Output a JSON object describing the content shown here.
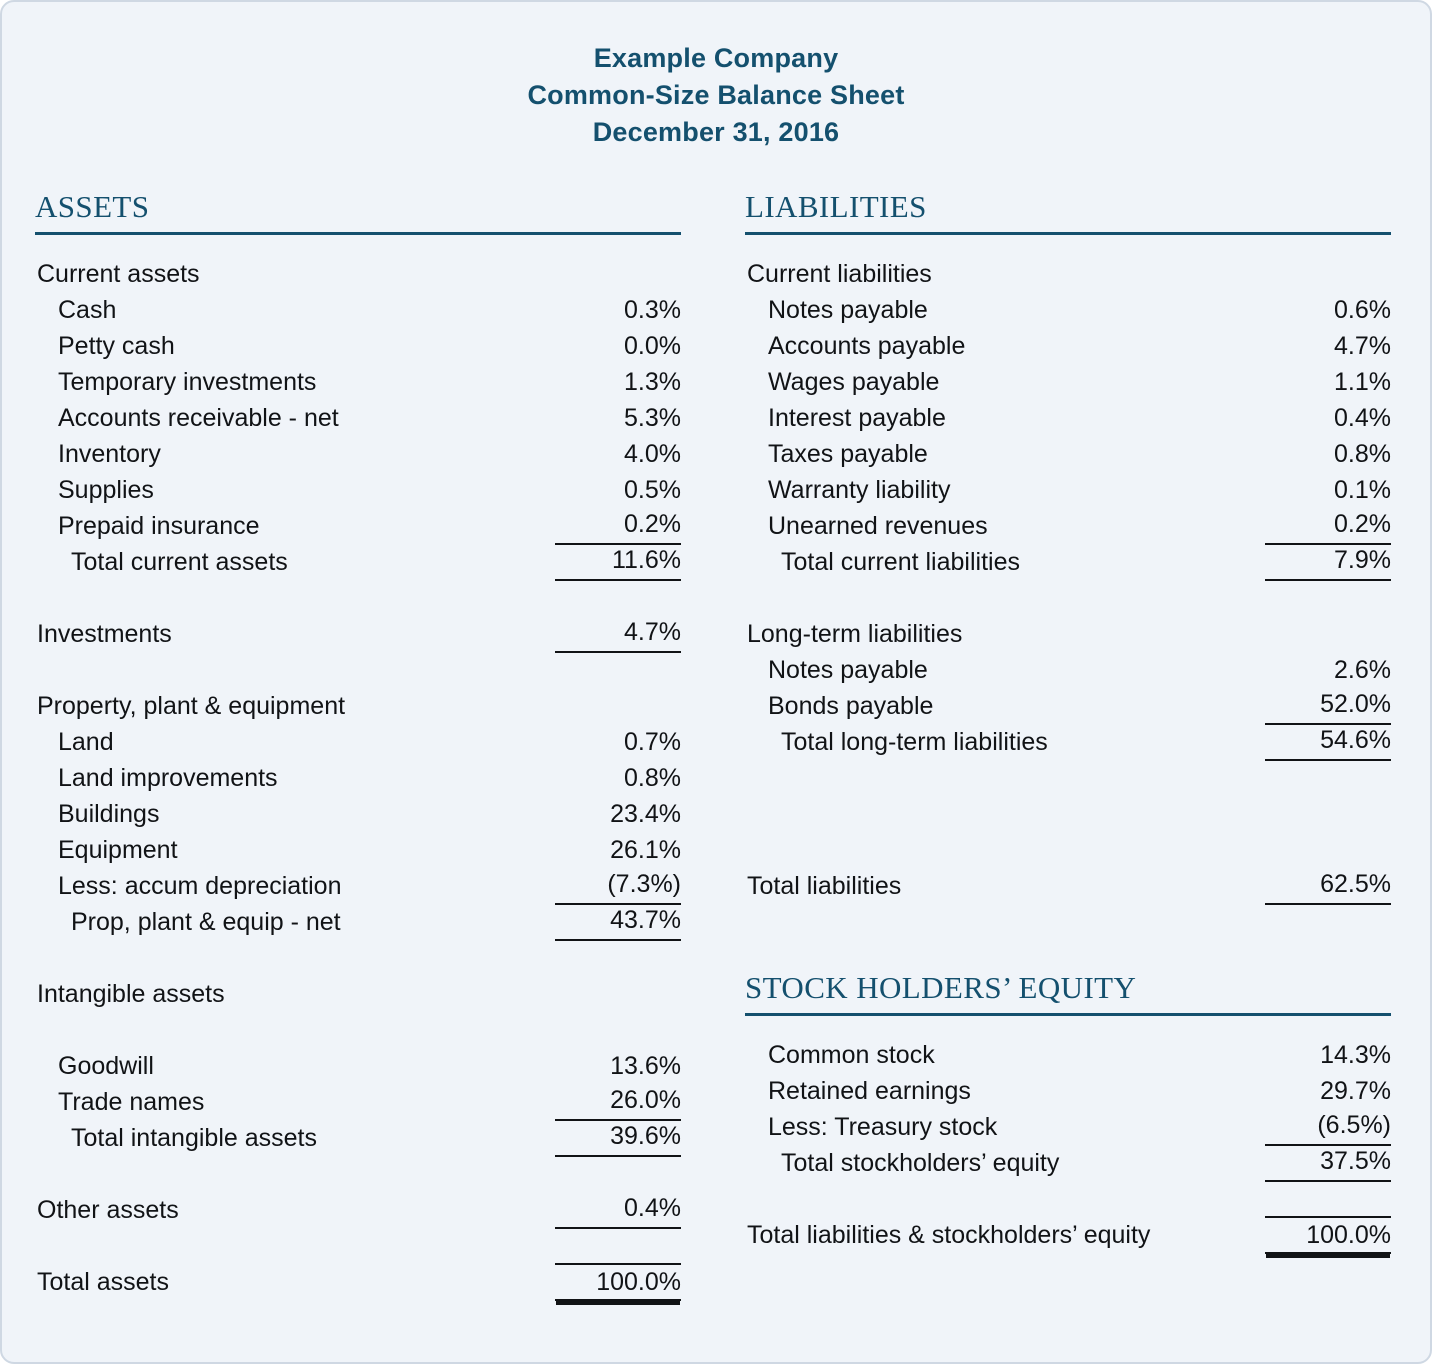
{
  "document": {
    "company": "Example Company",
    "statement_title": "Common-Size Balance Sheet",
    "date": "December 31, 2016",
    "accent_color": "#14506e",
    "text_color": "#111316",
    "background_color": "#f0f4f9",
    "border_color": "#cfd8e3"
  },
  "left_column": {
    "heading": "ASSETS",
    "rows": [
      {
        "label": "Current assets",
        "amount": "",
        "indent": 0,
        "rule": "none"
      },
      {
        "label": "Cash",
        "amount": "0.3%",
        "indent": 1,
        "rule": "none"
      },
      {
        "label": "Petty cash",
        "amount": "0.0%",
        "indent": 1,
        "rule": "none"
      },
      {
        "label": "Temporary investments",
        "amount": "1.3%",
        "indent": 1,
        "rule": "none"
      },
      {
        "label": "Accounts receivable - net",
        "amount": "5.3%",
        "indent": 1,
        "rule": "none"
      },
      {
        "label": "Inventory",
        "amount": "4.0%",
        "indent": 1,
        "rule": "none"
      },
      {
        "label": "Supplies",
        "amount": "0.5%",
        "indent": 1,
        "rule": "none"
      },
      {
        "label": "Prepaid insurance",
        "amount": "0.2%",
        "indent": 1,
        "rule": "bottom"
      },
      {
        "label": "Total current assets",
        "amount": "11.6%",
        "indent": 2,
        "rule": "bottom"
      },
      {
        "label": "",
        "amount": "",
        "indent": 0,
        "rule": "spacer"
      },
      {
        "label": "Investments",
        "amount": "4.7%",
        "indent": 0,
        "rule": "bottom"
      },
      {
        "label": "",
        "amount": "",
        "indent": 0,
        "rule": "spacer"
      },
      {
        "label": "Property, plant & equipment",
        "amount": "",
        "indent": 0,
        "rule": "none"
      },
      {
        "label": "Land",
        "amount": "0.7%",
        "indent": 1,
        "rule": "none"
      },
      {
        "label": "Land improvements",
        "amount": "0.8%",
        "indent": 1,
        "rule": "none"
      },
      {
        "label": "Buildings",
        "amount": "23.4%",
        "indent": 1,
        "rule": "none"
      },
      {
        "label": "Equipment",
        "amount": "26.1%",
        "indent": 1,
        "rule": "none"
      },
      {
        "label": "Less: accum depreciation",
        "amount": "(7.3%)",
        "indent": 1,
        "rule": "bottom"
      },
      {
        "label": "Prop, plant & equip - net",
        "amount": "43.7%",
        "indent": 2,
        "rule": "bottom"
      },
      {
        "label": "",
        "amount": "",
        "indent": 0,
        "rule": "spacer"
      },
      {
        "label": "Intangible assets",
        "amount": "",
        "indent": 0,
        "rule": "none"
      },
      {
        "label": "",
        "amount": "",
        "indent": 0,
        "rule": "spacer"
      },
      {
        "label": "Goodwill",
        "amount": "13.6%",
        "indent": 1,
        "rule": "none"
      },
      {
        "label": "Trade names",
        "amount": "26.0%",
        "indent": 1,
        "rule": "bottom"
      },
      {
        "label": "Total intangible assets",
        "amount": "39.6%",
        "indent": 2,
        "rule": "bottom"
      },
      {
        "label": "",
        "amount": "",
        "indent": 0,
        "rule": "spacer"
      },
      {
        "label": "Other assets",
        "amount": "0.4%",
        "indent": 0,
        "rule": "bottom"
      },
      {
        "label": "",
        "amount": "",
        "indent": 0,
        "rule": "spacer"
      },
      {
        "label": "Total assets",
        "amount": "100.0%",
        "indent": 0,
        "rule": "top-double"
      }
    ]
  },
  "right_column": {
    "heading_liabilities": "LIABILITIES",
    "heading_equity": "STOCK HOLDERS’ EQUITY",
    "liability_rows": [
      {
        "label": "Current liabilities",
        "amount": "",
        "indent": 0,
        "rule": "none"
      },
      {
        "label": "Notes payable",
        "amount": "0.6%",
        "indent": 1,
        "rule": "none"
      },
      {
        "label": "Accounts payable",
        "amount": "4.7%",
        "indent": 1,
        "rule": "none"
      },
      {
        "label": "Wages payable",
        "amount": "1.1%",
        "indent": 1,
        "rule": "none"
      },
      {
        "label": "Interest payable",
        "amount": "0.4%",
        "indent": 1,
        "rule": "none"
      },
      {
        "label": "Taxes payable",
        "amount": "0.8%",
        "indent": 1,
        "rule": "none"
      },
      {
        "label": "Warranty liability",
        "amount": "0.1%",
        "indent": 1,
        "rule": "none"
      },
      {
        "label": "Unearned revenues",
        "amount": "0.2%",
        "indent": 1,
        "rule": "bottom"
      },
      {
        "label": "Total current liabilities",
        "amount": "7.9%",
        "indent": 2,
        "rule": "bottom"
      },
      {
        "label": "",
        "amount": "",
        "indent": 0,
        "rule": "spacer"
      },
      {
        "label": "Long-term liabilities",
        "amount": "",
        "indent": 0,
        "rule": "none"
      },
      {
        "label": "Notes payable",
        "amount": "2.6%",
        "indent": 1,
        "rule": "none"
      },
      {
        "label": "Bonds payable",
        "amount": "52.0%",
        "indent": 1,
        "rule": "bottom"
      },
      {
        "label": "Total long-term liabilities",
        "amount": "54.6%",
        "indent": 2,
        "rule": "bottom"
      },
      {
        "label": "",
        "amount": "",
        "indent": 0,
        "rule": "spacer"
      },
      {
        "label": "",
        "amount": "",
        "indent": 0,
        "rule": "spacer"
      },
      {
        "label": "",
        "amount": "",
        "indent": 0,
        "rule": "spacer"
      },
      {
        "label": "Total liabilities",
        "amount": "62.5%",
        "indent": 0,
        "rule": "bottom"
      }
    ],
    "equity_rows": [
      {
        "label": "Common stock",
        "amount": "14.3%",
        "indent": 1,
        "rule": "none"
      },
      {
        "label": "Retained earnings",
        "amount": "29.7%",
        "indent": 1,
        "rule": "none"
      },
      {
        "label": "Less: Treasury stock",
        "amount": "(6.5%)",
        "indent": 1,
        "rule": "bottom"
      },
      {
        "label": "Total stockholders’ equity",
        "amount": "37.5%",
        "indent": 2,
        "rule": "bottom"
      }
    ],
    "grand_total_rows": [
      {
        "label": "",
        "amount": "",
        "indent": 0,
        "rule": "spacer"
      },
      {
        "label": "Total liabilities & stockholders’ equity",
        "amount": "100.0%",
        "indent": 0,
        "rule": "top-double"
      }
    ]
  }
}
